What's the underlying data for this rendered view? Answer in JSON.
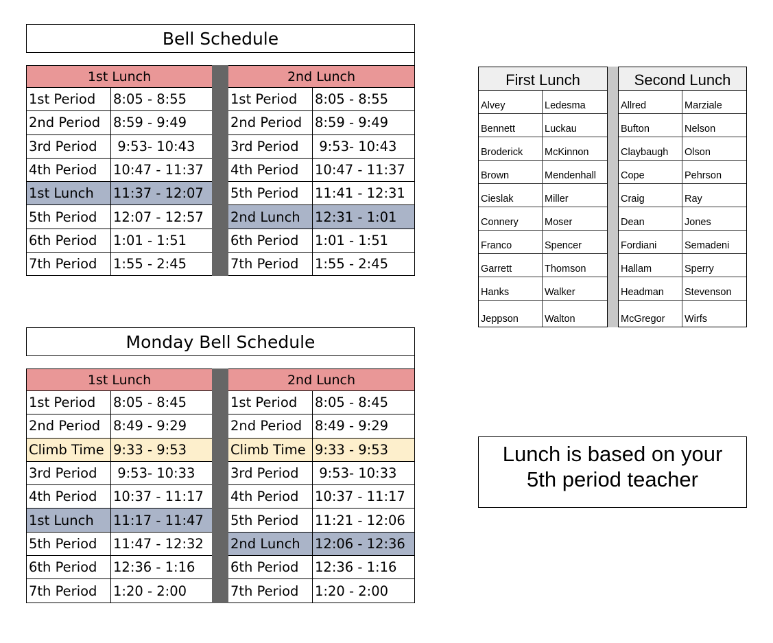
{
  "regular_schedule": {
    "title": "Bell Schedule",
    "columns": [
      {
        "header": "1st Lunch",
        "rows": [
          {
            "name": "1st Period",
            "time": "8:05 - 8:55",
            "type": "period"
          },
          {
            "name": "2nd Period",
            "time": "8:59 - 9:49",
            "type": "period"
          },
          {
            "name": "3rd Period",
            "time": " 9:53- 10:43",
            "type": "period"
          },
          {
            "name": "4th Period",
            "time": "10:47 - 11:37",
            "type": "period"
          },
          {
            "name": "1st Lunch",
            "time": "11:37 - 12:07",
            "type": "lunch"
          },
          {
            "name": "5th Period",
            "time": "12:07 - 12:57",
            "type": "period"
          },
          {
            "name": "6th Period",
            "time": "1:01 - 1:51",
            "type": "period"
          },
          {
            "name": "7th Period",
            "time": "1:55 - 2:45",
            "type": "period"
          }
        ]
      },
      {
        "header": "2nd Lunch",
        "rows": [
          {
            "name": "1st Period",
            "time": "8:05 - 8:55",
            "type": "period"
          },
          {
            "name": "2nd Period",
            "time": "8:59 - 9:49",
            "type": "period"
          },
          {
            "name": "3rd Period",
            "time": " 9:53- 10:43",
            "type": "period"
          },
          {
            "name": "4th Period",
            "time": "10:47 - 11:37",
            "type": "period"
          },
          {
            "name": "5th Period",
            "time": "11:41 - 12:31",
            "type": "period"
          },
          {
            "name": "2nd Lunch",
            "time": "12:31 - 1:01",
            "type": "lunch"
          },
          {
            "name": "6th Period",
            "time": "1:01 - 1:51",
            "type": "period"
          },
          {
            "name": "7th Period",
            "time": "1:55 - 2:45",
            "type": "period"
          }
        ]
      }
    ]
  },
  "monday_schedule": {
    "title": "Monday Bell Schedule",
    "columns": [
      {
        "header": "1st Lunch",
        "rows": [
          {
            "name": "1st Period",
            "time": "8:05 - 8:45",
            "type": "period"
          },
          {
            "name": "2nd Period",
            "time": "8:49 - 9:29",
            "type": "period"
          },
          {
            "name": "Climb Time",
            "time": "9:33 - 9:53",
            "type": "climb"
          },
          {
            "name": "3rd Period",
            "time": " 9:53- 10:33",
            "type": "period"
          },
          {
            "name": "4th Period",
            "time": "10:37 - 11:17",
            "type": "period"
          },
          {
            "name": "1st Lunch",
            "time": "11:17 - 11:47",
            "type": "lunch"
          },
          {
            "name": "5th Period",
            "time": "11:47 - 12:32",
            "type": "period"
          },
          {
            "name": "6th Period",
            "time": "12:36 - 1:16",
            "type": "period"
          },
          {
            "name": "7th Period",
            "time": "1:20 - 2:00",
            "type": "period"
          }
        ]
      },
      {
        "header": "2nd Lunch",
        "rows": [
          {
            "name": "1st Period",
            "time": "8:05 - 8:45",
            "type": "period"
          },
          {
            "name": "2nd Period",
            "time": "8:49 - 9:29",
            "type": "period"
          },
          {
            "name": "Climb Time",
            "time": "9:33 - 9:53",
            "type": "climb"
          },
          {
            "name": "3rd Period",
            "time": " 9:53- 10:33",
            "type": "period"
          },
          {
            "name": "4th Period",
            "time": "10:37 - 11:17",
            "type": "period"
          },
          {
            "name": "5th Period",
            "time": "11:21 - 12:06",
            "type": "period"
          },
          {
            "name": "2nd Lunch",
            "time": "12:06 - 12:36",
            "type": "lunch"
          },
          {
            "name": "6th Period",
            "time": "12:36 - 1:16",
            "type": "period"
          },
          {
            "name": "7th Period",
            "time": "1:20 - 2:00",
            "type": "period"
          }
        ]
      }
    ]
  },
  "teacher_lists": [
    {
      "header": "First Lunch",
      "rows": [
        [
          "Alvey",
          "Ledesma"
        ],
        [
          "Bennett",
          "Luckau"
        ],
        [
          "Broderick",
          "McKinnon"
        ],
        [
          "Brown",
          "Mendenhall"
        ],
        [
          "Cieslak",
          "Miller"
        ],
        [
          "Connery",
          "Moser"
        ],
        [
          "Franco",
          "Spencer"
        ],
        [
          "Garrett",
          "Thomson"
        ],
        [
          "Hanks",
          "Walker"
        ],
        [
          "Jeppson",
          "Walton"
        ]
      ]
    },
    {
      "header": "Second Lunch",
      "rows": [
        [
          "Allred",
          "Marziale"
        ],
        [
          "Bufton",
          "Nelson"
        ],
        [
          "Claybaugh",
          "Olson"
        ],
        [
          "Cope",
          "Pehrson"
        ],
        [
          "Craig",
          "Ray"
        ],
        [
          "Dean",
          "Jones"
        ],
        [
          "Fordiani",
          "Semadeni"
        ],
        [
          "Hallam",
          "Sperry"
        ],
        [
          "Headman",
          "Stevenson"
        ],
        [
          "McGregor",
          "Wirfs"
        ]
      ]
    }
  ],
  "note": {
    "line1": "Lunch is based on your",
    "line2": "5th period teacher"
  },
  "colors": {
    "column_header": "#e99797",
    "lunch_row": "#aab4c8",
    "climb_row": "#fdefcc",
    "divider": "#666666",
    "teacher_header": "#efefef",
    "teacher_gap": "#c8c8c8"
  }
}
